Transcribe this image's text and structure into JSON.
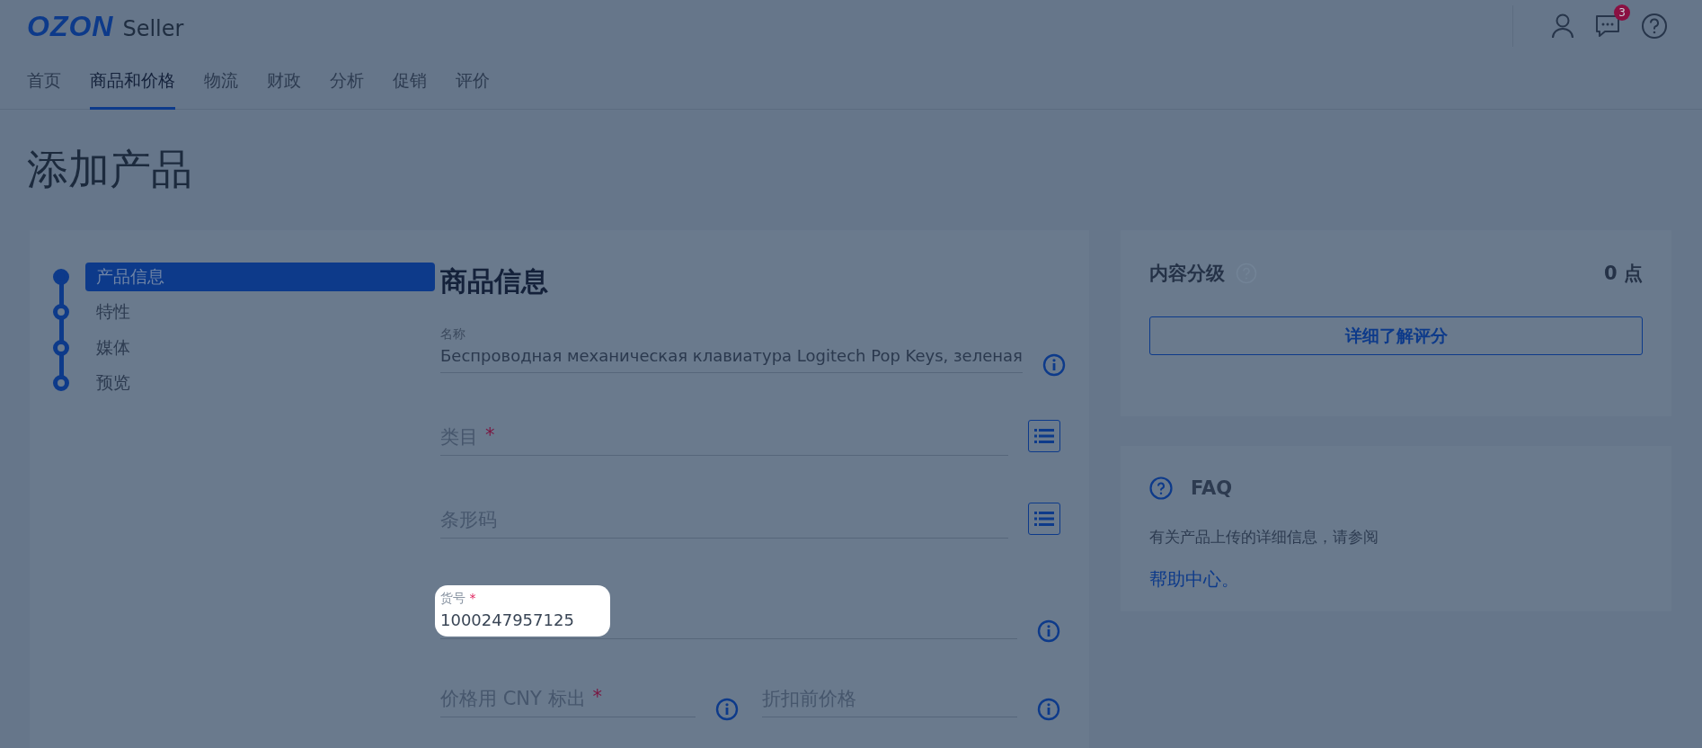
{
  "header": {
    "logo": "OZON",
    "logo_suffix": "Seller",
    "chat_badge": "3"
  },
  "nav": [
    {
      "label": "首页",
      "selected": false
    },
    {
      "label": "商品和价格",
      "selected": true
    },
    {
      "label": "物流",
      "selected": false
    },
    {
      "label": "财政",
      "selected": false
    },
    {
      "label": "分析",
      "selected": false
    },
    {
      "label": "促销",
      "selected": false
    },
    {
      "label": "评价",
      "selected": false
    }
  ],
  "page_title": "添加产品",
  "steps": [
    {
      "label": "产品信息",
      "selected": true
    },
    {
      "label": "特性",
      "selected": false
    },
    {
      "label": "媒体",
      "selected": false
    },
    {
      "label": "预览",
      "selected": false
    }
  ],
  "form": {
    "title": "商品信息",
    "fields": [
      {
        "kind": "text",
        "label": "名称",
        "value": "Беспроводная механическая клавиатура Logitech Pop Keys, зеленая",
        "highlighted": false
      },
      {
        "kind": "select",
        "placeholder": "类目",
        "required_mark": "*"
      },
      {
        "kind": "select",
        "placeholder": "条形码"
      },
      {
        "kind": "text",
        "label": "货号",
        "required_mark": "*",
        "value": "1000247957125",
        "highlighted": true
      },
      {
        "kind": "pair",
        "items": [
          {
            "placeholder": "价格用 CNY 标出",
            "required_mark": "*"
          },
          {
            "placeholder": "折扣前价格"
          }
        ]
      }
    ]
  },
  "rating": {
    "title": "内容分级",
    "score": "0 点",
    "button": "详细了解评分"
  },
  "faq": {
    "title": "FAQ",
    "text": "有关产品上传的详细信息，请参阅",
    "link": "帮助中心。"
  }
}
